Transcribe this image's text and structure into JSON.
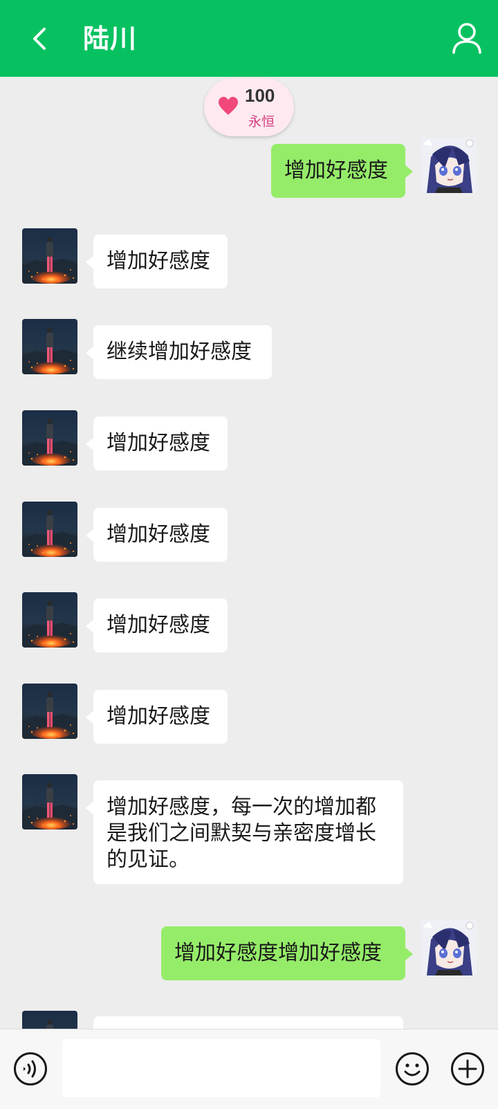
{
  "header": {
    "title": "陆川",
    "back_icon": "chevron-left-icon",
    "profile_icon": "user-icon",
    "background": "#07c160"
  },
  "affinity": {
    "value": "100",
    "label": "永恒",
    "icon": "heart-icon",
    "heart_color": "#f0487a"
  },
  "messages": [
    {
      "side": "out",
      "text": "增加好感度"
    },
    {
      "side": "in",
      "text": "增加好感度"
    },
    {
      "side": "in",
      "text": "继续增加好感度"
    },
    {
      "side": "in",
      "text": "增加好感度"
    },
    {
      "side": "in",
      "text": "增加好感度"
    },
    {
      "side": "in",
      "text": "增加好感度"
    },
    {
      "side": "in",
      "text": "增加好感度"
    },
    {
      "side": "in",
      "text": "增加好感度，每一次的增加都\n是我们之间默契与亲密度增长\n的见证。"
    },
    {
      "side": "out",
      "text": "增加好感度增加好感度"
    },
    {
      "side": "in",
      "text": ""
    }
  ],
  "input_bar": {
    "voice_icon": "voice-icon",
    "emoji_icon": "emoji-icon",
    "plus_icon": "plus-icon",
    "input_value": "",
    "input_placeholder": ""
  },
  "colors": {
    "bubble_out": "#95ec69",
    "bubble_in": "#ffffff",
    "chat_background": "#ededed"
  }
}
